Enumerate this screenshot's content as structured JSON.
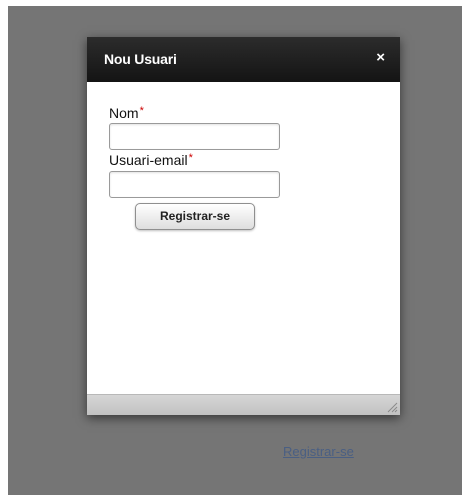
{
  "dialog": {
    "title": "Nou Usuari",
    "close_symbol": "×",
    "fields": [
      {
        "label": "Nom",
        "required_mark": "*",
        "value": ""
      },
      {
        "label": "Usuari-email",
        "required_mark": "*",
        "value": ""
      }
    ],
    "submit_label": "Registrar-se"
  },
  "page": {
    "link_label": "Registrar-se"
  },
  "colors": {
    "overlay": "#757575",
    "header": "#1c1c1c",
    "required": "#cc0000",
    "link": "#4a5f83"
  }
}
